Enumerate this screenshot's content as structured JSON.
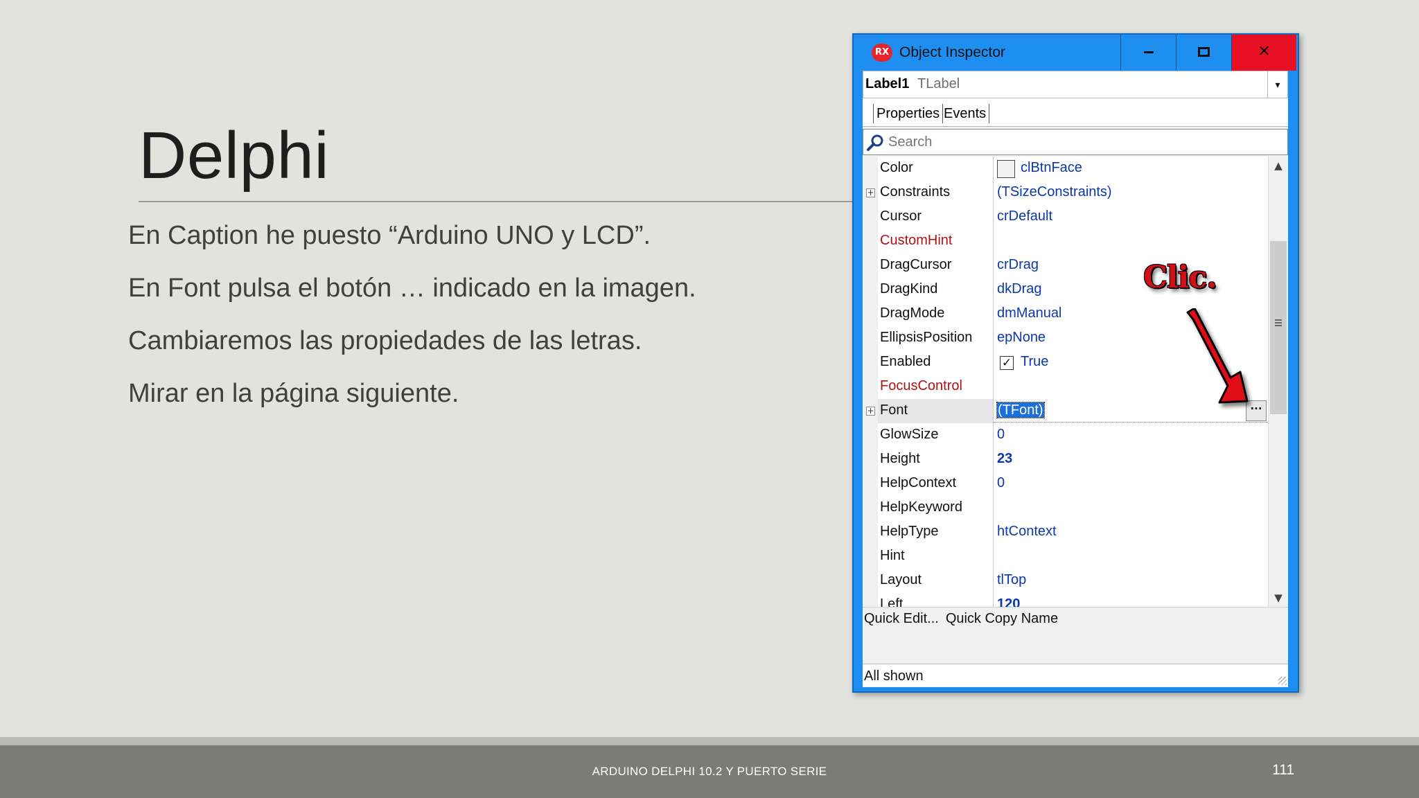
{
  "slide": {
    "title": "Delphi",
    "bullets": [
      "En Caption he puesto “Arduino UNO y LCD”.",
      "En Font pulsa el botón … indicado en la imagen.",
      "Cambiaremos las propiedades de las letras.",
      "Mirar en la página siguiente."
    ],
    "footer_text": "ARDUINO DELPHI 10.2 Y PUERTO SERIE",
    "page_number": "111"
  },
  "window": {
    "title": "Object Inspector",
    "logo_text": "RX",
    "controls": {
      "minimize": "minimize-icon",
      "maximize": "maximize-icon",
      "close": "✕"
    }
  },
  "object_selector": {
    "name": "Label1",
    "type": "TLabel",
    "dropdown_icon": "▾"
  },
  "tabs": [
    "Properties",
    "Events"
  ],
  "search": {
    "placeholder": "Search",
    "icon": "search-icon"
  },
  "properties": [
    {
      "name": "Color",
      "value": "clBtnFace",
      "swatch": true
    },
    {
      "name": "Constraints",
      "value": "(TSizeConstraints)",
      "expandable": true
    },
    {
      "name": "Cursor",
      "value": "crDefault"
    },
    {
      "name": "CustomHint",
      "value": "",
      "highlight": "red"
    },
    {
      "name": "DragCursor",
      "value": "crDrag"
    },
    {
      "name": "DragKind",
      "value": "dkDrag"
    },
    {
      "name": "DragMode",
      "value": "dmManual"
    },
    {
      "name": "EllipsisPosition",
      "value": "epNone"
    },
    {
      "name": "Enabled",
      "value": "True",
      "checkbox": true
    },
    {
      "name": "FocusControl",
      "value": "",
      "highlight": "red"
    },
    {
      "name": "Font",
      "value": "(TFont)",
      "expandable": true,
      "selected": true,
      "ellipsis_button": "···"
    },
    {
      "name": "GlowSize",
      "value": "0"
    },
    {
      "name": "Height",
      "value": "23",
      "bold": true
    },
    {
      "name": "HelpContext",
      "value": "0"
    },
    {
      "name": "HelpKeyword",
      "value": ""
    },
    {
      "name": "HelpType",
      "value": "htContext"
    },
    {
      "name": "Hint",
      "value": ""
    },
    {
      "name": "Layout",
      "value": "tlTop"
    },
    {
      "name": "Left",
      "value": "120",
      "bold": true
    }
  ],
  "quick_links": [
    "Quick Edit...",
    "Quick Copy Name"
  ],
  "status": "All shown",
  "annotation": {
    "text": "Clic.",
    "color": "#d01018"
  },
  "colors": {
    "window_frame": "#1e8ef0",
    "close_button": "#e81123",
    "value_text": "#0a38a8",
    "red_property": "#b01010",
    "selection": "#1a6fd8"
  }
}
